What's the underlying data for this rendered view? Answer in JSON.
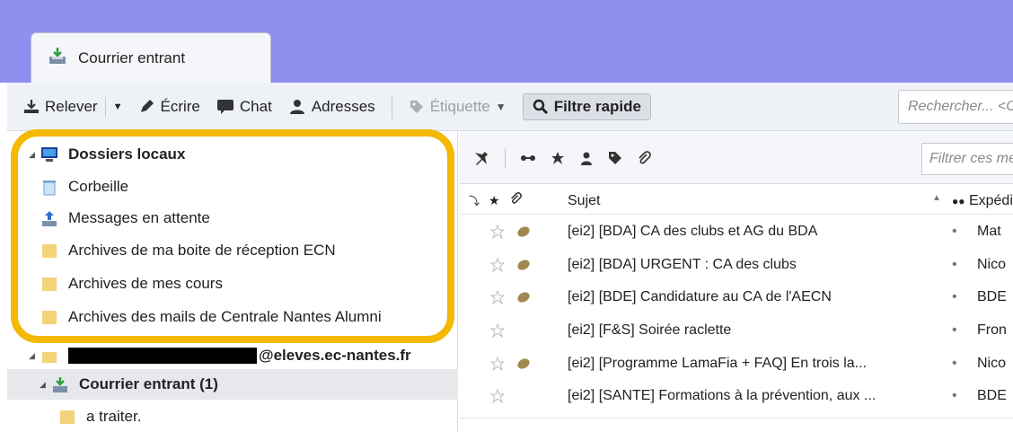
{
  "tab": {
    "label": "Courrier entrant"
  },
  "toolbar": {
    "get_mail": "Relever",
    "write": "Écrire",
    "chat": "Chat",
    "address_book": "Adresses",
    "tag": "Étiquette",
    "quick_filter": "Filtre rapide",
    "search_placeholder": "Rechercher... <Ctrl+K>"
  },
  "sidebar": {
    "local_folders": "Dossiers locaux",
    "trash": "Corbeille",
    "outbox": "Messages en attente",
    "archive1": "Archives de ma boite de réception ECN",
    "archive2": "Archives de mes cours",
    "archive3": "Archives des mails de Centrale Nantes Alumni",
    "account": "@eleves.ec-nantes.fr",
    "inbox": "Courrier entrant (1)",
    "subfolder": "a traiter."
  },
  "message_list": {
    "filter_placeholder": "Filtrer ces messages",
    "col_subject": "Sujet",
    "col_from": "Expéditeur",
    "messages": [
      {
        "subject": "[ei2] [BDA] CA des clubs et AG du BDA",
        "from": "Mat",
        "attachment": true
      },
      {
        "subject": "[ei2] [BDA] URGENT : CA des clubs",
        "from": "Nico",
        "attachment": true
      },
      {
        "subject": "[ei2] [BDE] Candidature au CA de l'AECN",
        "from": "BDE",
        "attachment": true
      },
      {
        "subject": "[ei2] [F&S] Soirée raclette",
        "from": "Fron",
        "attachment": false
      },
      {
        "subject": "[ei2] [Programme LamaFia + FAQ] En trois la...",
        "from": "Nico",
        "attachment": true
      },
      {
        "subject": "[ei2] [SANTE] Formations à la prévention, aux ...",
        "from": "BDE",
        "attachment": false
      }
    ]
  },
  "colors": {
    "accent_highlight": "#f5b800",
    "tab_strip": "#8f8ff0"
  }
}
